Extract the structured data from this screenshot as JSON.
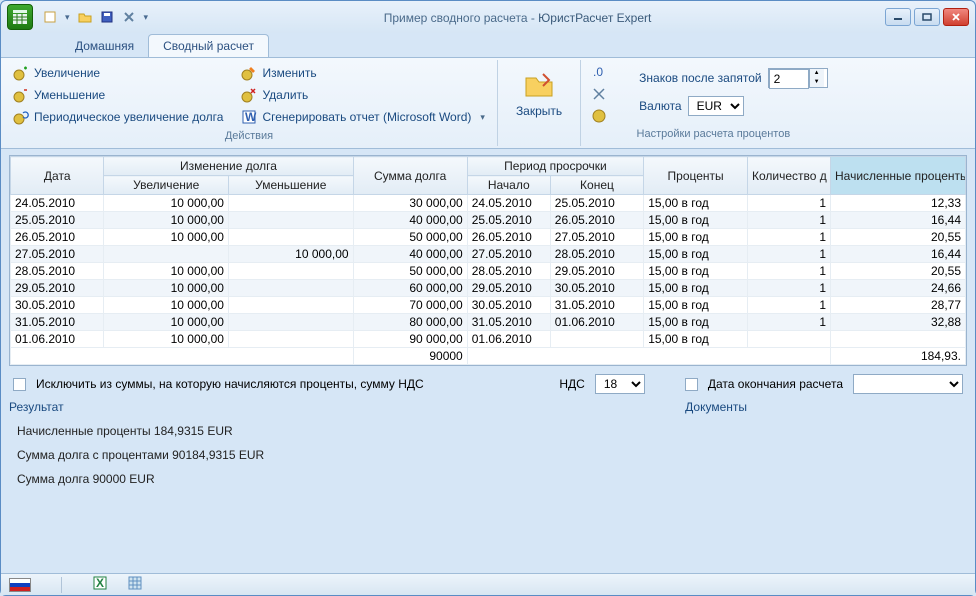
{
  "window": {
    "title_prefix": "Пример сводного расчета - ",
    "title_brand": "ЮристРасчет Expert"
  },
  "tabs": [
    {
      "label": "Домашняя",
      "active": false
    },
    {
      "label": "Сводный расчет",
      "active": true
    }
  ],
  "ribbon": {
    "actions_group": "Действия",
    "settings_group": "Настройки расчета процентов",
    "increase": "Увеличение",
    "decrease": "Уменьшение",
    "periodic_increase": "Периодическое увеличение долга",
    "edit": "Изменить",
    "delete": "Удалить",
    "generate_report": "Сгенерировать отчет (Microsoft Word)",
    "close": "Закрыть",
    "decimals_label": "Знаков после запятой",
    "decimals_value": "2",
    "currency_label": "Валюта",
    "currency_value": "EUR"
  },
  "grid": {
    "headers": {
      "date": "Дата",
      "debt_change": "Изменение долга",
      "increase": "Увеличение",
      "decrease": "Уменьшение",
      "debt_sum": "Сумма долга",
      "overdue_period": "Период просрочки",
      "start": "Начало",
      "end": "Конец",
      "interest": "Проценты",
      "days_count": "Количество д",
      "accrued": "Начисленные проценты",
      "accrued_cut": "Начисленные проценты"
    },
    "rows": [
      {
        "date": "24.05.2010",
        "inc": "10 000,00",
        "dec": "",
        "sum": "30 000,00",
        "start": "24.05.2010",
        "end": "25.05.2010",
        "rate": "15,00 в год",
        "days": "1",
        "acc": "12,33"
      },
      {
        "date": "25.05.2010",
        "inc": "10 000,00",
        "dec": "",
        "sum": "40 000,00",
        "start": "25.05.2010",
        "end": "26.05.2010",
        "rate": "15,00 в год",
        "days": "1",
        "acc": "16,44"
      },
      {
        "date": "26.05.2010",
        "inc": "10 000,00",
        "dec": "",
        "sum": "50 000,00",
        "start": "26.05.2010",
        "end": "27.05.2010",
        "rate": "15,00 в год",
        "days": "1",
        "acc": "20,55"
      },
      {
        "date": "27.05.2010",
        "inc": "",
        "dec": "10 000,00",
        "sum": "40 000,00",
        "start": "27.05.2010",
        "end": "28.05.2010",
        "rate": "15,00 в год",
        "days": "1",
        "acc": "16,44"
      },
      {
        "date": "28.05.2010",
        "inc": "10 000,00",
        "dec": "",
        "sum": "50 000,00",
        "start": "28.05.2010",
        "end": "29.05.2010",
        "rate": "15,00 в год",
        "days": "1",
        "acc": "20,55"
      },
      {
        "date": "29.05.2010",
        "inc": "10 000,00",
        "dec": "",
        "sum": "60 000,00",
        "start": "29.05.2010",
        "end": "30.05.2010",
        "rate": "15,00 в год",
        "days": "1",
        "acc": "24,66"
      },
      {
        "date": "30.05.2010",
        "inc": "10 000,00",
        "dec": "",
        "sum": "70 000,00",
        "start": "30.05.2010",
        "end": "31.05.2010",
        "rate": "15,00 в год",
        "days": "1",
        "acc": "28,77"
      },
      {
        "date": "31.05.2010",
        "inc": "10 000,00",
        "dec": "",
        "sum": "80 000,00",
        "start": "31.05.2010",
        "end": "01.06.2010",
        "rate": "15,00 в год",
        "days": "1",
        "acc": "32,88"
      },
      {
        "date": "01.06.2010",
        "inc": "10 000,00",
        "dec": "",
        "sum": "90 000,00",
        "start": "01.06.2010",
        "end": "",
        "rate": "15,00 в год",
        "days": "",
        "acc": ""
      }
    ],
    "sum_debt": "90000",
    "sum_accrued": "184,93."
  },
  "bottom": {
    "exclude_vat": "Исключить из суммы, на которую начисляются проценты, сумму НДС",
    "vat_label": "НДС",
    "vat_value": "18",
    "calc_end_date": "Дата окончания расчета",
    "result_heading": "Результат",
    "documents_heading": "Документы"
  },
  "results": {
    "line1": "Начисленные проценты 184,9315 EUR",
    "line2": "Сумма долга с процентами 90184,9315 EUR",
    "line3": "Сумма долга 90000 EUR"
  }
}
